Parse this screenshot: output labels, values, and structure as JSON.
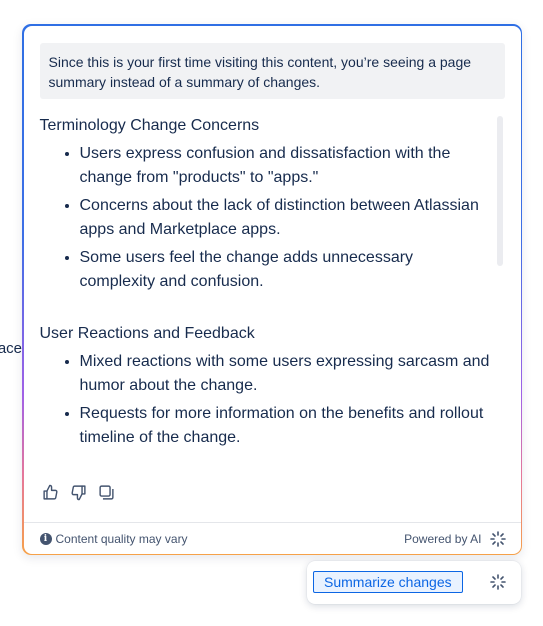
{
  "background": {
    "partial_text": "Marketplace"
  },
  "summary_panel": {
    "notice": "Since this is your first time visiting this content, you’re seeing a page summary instead of a summary of changes.",
    "sections": [
      {
        "heading": "Terminology Change Concerns",
        "bullets": [
          "Users express confusion and dissatisfaction with the change from \"products\" to \"apps.\"",
          "Concerns about the lack of distinction between Atlassian apps and Marketplace apps.",
          "Some users feel the change adds unnecessary complexity and confusion."
        ]
      },
      {
        "heading": "User Reactions and Feedback",
        "bullets": [
          "Mixed reactions with some users expressing sarcasm and humor about the change.",
          "Requests for more information on the benefits and rollout timeline of the change."
        ]
      }
    ],
    "feedback_icons": [
      "thumbs-up-icon",
      "thumbs-down-icon",
      "copy-icon"
    ],
    "footer": {
      "quality_note": "Content quality may vary",
      "powered_by": "Powered by AI"
    }
  },
  "summarize": {
    "button_label": "Summarize changes"
  },
  "colors": {
    "accent": "#0c66e4",
    "gradient_top": "#2f6fe4",
    "gradient_bottom": "#f6a149",
    "text": "#172b4d"
  }
}
